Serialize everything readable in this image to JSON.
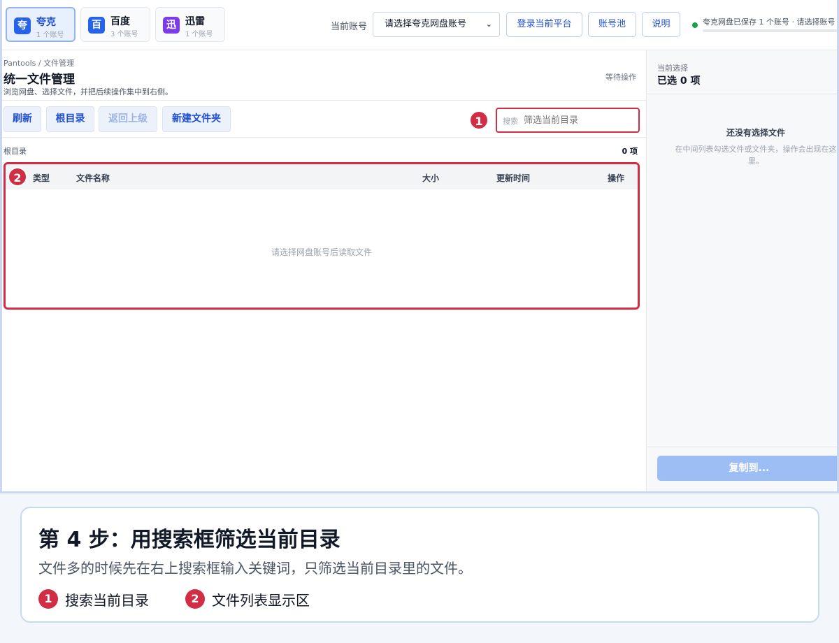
{
  "platforms": [
    {
      "badge": "夸",
      "name": "夸克",
      "accounts": "1 个账号",
      "color": "#2563eb"
    },
    {
      "badge": "百",
      "name": "百度",
      "accounts": "3 个账号",
      "color": "#2563eb"
    },
    {
      "badge": "迅",
      "name": "迅雷",
      "accounts": "1 个账号",
      "color": "#7c3aed"
    }
  ],
  "header": {
    "account_label": "当前账号",
    "account_select": "请选择夸克网盘账号",
    "login_button": "登录当前平台",
    "pool_button": "账号池",
    "help_button": "说明",
    "status": "夸克网盘已保存 1 个账号 · 请选择账号",
    "status_color": "#16a34a"
  },
  "main": {
    "breadcrumb": "Pantools / 文件管理",
    "title": "统一文件管理",
    "description": "浏览网盘、选择文件，并把后续操作集中到右侧。",
    "waiting": "等待操作",
    "actions": {
      "refresh": "刷新",
      "root": "根目录",
      "back": "返回上级",
      "new_folder": "新建文件夹"
    },
    "search": {
      "label": "搜索",
      "placeholder": "筛选当前目录"
    },
    "path": "根目录",
    "count": "0 项",
    "table": {
      "col_type": "类型",
      "col_name": "文件名称",
      "col_size": "大小",
      "col_time": "更新时间",
      "col_actions": "操作",
      "empty": "请选择网盘账号后读取文件"
    }
  },
  "side": {
    "current_label": "当前选择",
    "selected": "已选 0 项",
    "empty_title": "还没有选择文件",
    "empty_desc": "在中间列表勾选文件或文件夹，操作会出现在这里。",
    "copy_button": "复制到..."
  },
  "markers": {
    "m1": "1",
    "m2": "2"
  },
  "guide": {
    "step_title": "第 4 步：用搜索框筛选当前目录",
    "step_desc": "文件多的时候先在右上搜索框输入关键词，只筛选当前目录里的文件。",
    "legend": [
      {
        "num": "1",
        "text": "搜索当前目录"
      },
      {
        "num": "2",
        "text": "文件列表显示区"
      }
    ]
  },
  "accent_color": "#d12d45"
}
